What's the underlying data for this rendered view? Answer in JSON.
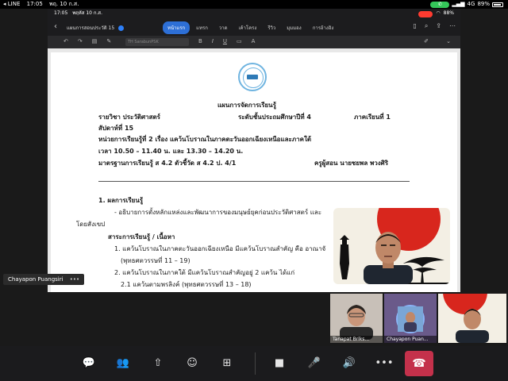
{
  "status_bar": {
    "carrier": "◂ LINE",
    "time": "17:05",
    "date": "พฤ. 10 ก.ส.",
    "signal": "4G",
    "battery": "89%"
  },
  "ipad": {
    "status_time": "17:05",
    "status_date": "พฤหัส 10 ก.ส.",
    "status_battery": "88%",
    "doc_title": "แผนการสอนประวัติ 15",
    "tabs": [
      "หน้าแรก",
      "แทรก",
      "วาด",
      "เค้าโครง",
      "รีวิว",
      "มุมมอง",
      "การอ้างอิง"
    ],
    "active_tab": 0,
    "font_name": "TH SarabunPSK"
  },
  "document": {
    "title": "แผนการจัดการเรียนรู้",
    "subject": "รายวิชา ประวัติศาสตร์",
    "level": "ระดับชั้นประถมศึกษาปีที่ 4",
    "term": "ภาคเรียนที่ 1",
    "week": "สัปดาห์ที่ 15",
    "unit": "หน่วยการเรียนรู้ที่ 2 เรื่อง แคว้นโบราณในภาคตะวันออกเฉียงเหนือและภาคใต้",
    "time": "เวลา 10.50 – 11.40 น. และ 13.30 – 14.20 น.",
    "standard": "มาตรฐานการเรียนรู้  ส 4.2  ตัวชี้วัด  ส 4.2 ป. 4/1",
    "teacher": "ครูผู้สอน นายชยพล พวงศิริ",
    "section1": "1.   ผลการเรียนรู้",
    "outcome": "- อธิบายการตั้งหลักแหล่งและพัฒนาการของมนุษย์ยุคก่อนประวัติศาสตร์ และ",
    "outcome2": "โดยสังเขป",
    "content_head": "สาระการเรียนรู้ / เนื้อหา",
    "item1": "1. แคว้นโบราณในภาคตะวันออกเฉียงเหนือ มีแคว้นโบราณสำคัญ คือ อาณาจั",
    "item1b": "(พุทธศตวรรษที่  11 – 19)",
    "item2": "2. แคว้นโบราณในภาคใต้ มีแคว้นโบราณสำคัญอยู่ 2 แคว้น ได้แก่",
    "item2a": "2.1 แคว้นตามพรลิงค์ (พุทธศตวรรษที่ 13 – 18)"
  },
  "presenter_tag": {
    "name": "Chayapon Puangsiri",
    "more": "•••"
  },
  "participants": [
    {
      "name": "Tanapat Briks..."
    },
    {
      "name": "Chayapon Puan..."
    },
    {
      "name": ""
    }
  ],
  "controls": {
    "chat": "chat",
    "people": "people",
    "share": "share",
    "reactions": "reactions",
    "apps": "apps",
    "camera": "camera",
    "mic": "mic",
    "speaker": "speaker",
    "more": "more",
    "leave": "leave"
  },
  "colors": {
    "accent": "#2d6fd6",
    "end_call": "#c4314b",
    "call_pill": "#34c759"
  }
}
